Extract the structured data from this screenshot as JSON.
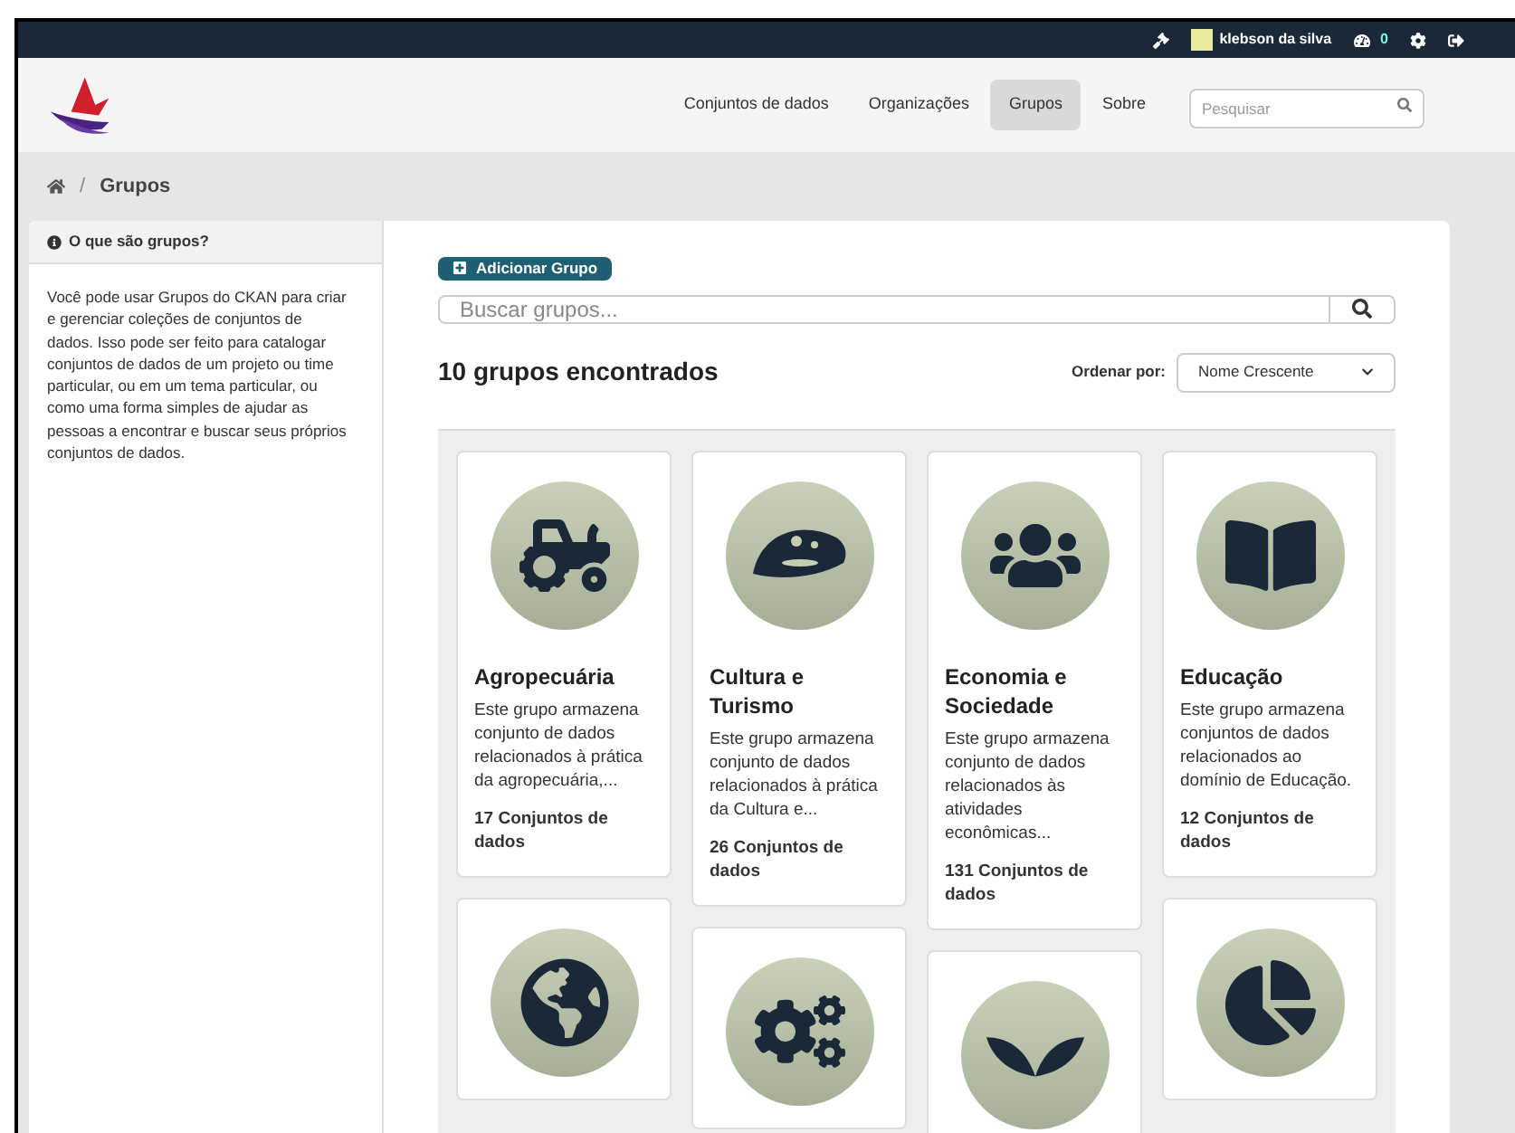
{
  "account_bar": {
    "user": "klebson da silva",
    "count": "0"
  },
  "nav": {
    "items": [
      {
        "label": "Conjuntos de dados",
        "selected": false
      },
      {
        "label": "Organizações",
        "selected": false
      },
      {
        "label": "Grupos",
        "selected": true
      },
      {
        "label": "Sobre",
        "selected": false
      }
    ],
    "search": {
      "placeholder": "Pesquisar"
    }
  },
  "breadcrumb": {
    "separator": "/",
    "current": "Grupos"
  },
  "sidebar": {
    "title": "O que são grupos?",
    "text": "Você pode usar Grupos do CKAN para criar e gerenciar coleções de conjuntos de dados. Isso pode ser feito para catalogar conjuntos de dados de um projeto ou time particular, ou em um tema particular, ou como uma forma simples de ajudar as pessoas a encontrar e buscar seus próprios conjuntos de dados."
  },
  "main": {
    "add_button": "Adicionar Grupo",
    "search": {
      "placeholder": "Buscar grupos..."
    },
    "result_count": "10 grupos encontrados",
    "sort": {
      "label": "Ordenar por:",
      "value": "Nome Crescente"
    }
  },
  "groups": [
    {
      "kind": "tractor",
      "title": "Agropecuária",
      "description": "Este grupo armazena conjunto de dados relacionados à prática da agropecuária,...",
      "count": "17 Conjuntos de dados"
    },
    {
      "kind": "hat",
      "title": "Cultura e Turismo",
      "description": "Este grupo armazena conjunto de dados relacionados à prática da Cultura e...",
      "count": "26 Conjuntos de dados"
    },
    {
      "kind": "people",
      "title": "Economia e Sociedade",
      "description": "Este grupo armazena conjunto de dados relacionados às atividades econômicas...",
      "count": "131 Conjuntos de dados"
    },
    {
      "kind": "book",
      "title": "Educação",
      "description": "Este grupo armazena conjuntos de dados relacionados ao domínio de Educação.",
      "count": "12 Conjuntos de dados"
    },
    {
      "kind": "globe"
    },
    {
      "kind": "gears"
    },
    {
      "kind": "leaves"
    },
    {
      "kind": "pie"
    }
  ]
}
